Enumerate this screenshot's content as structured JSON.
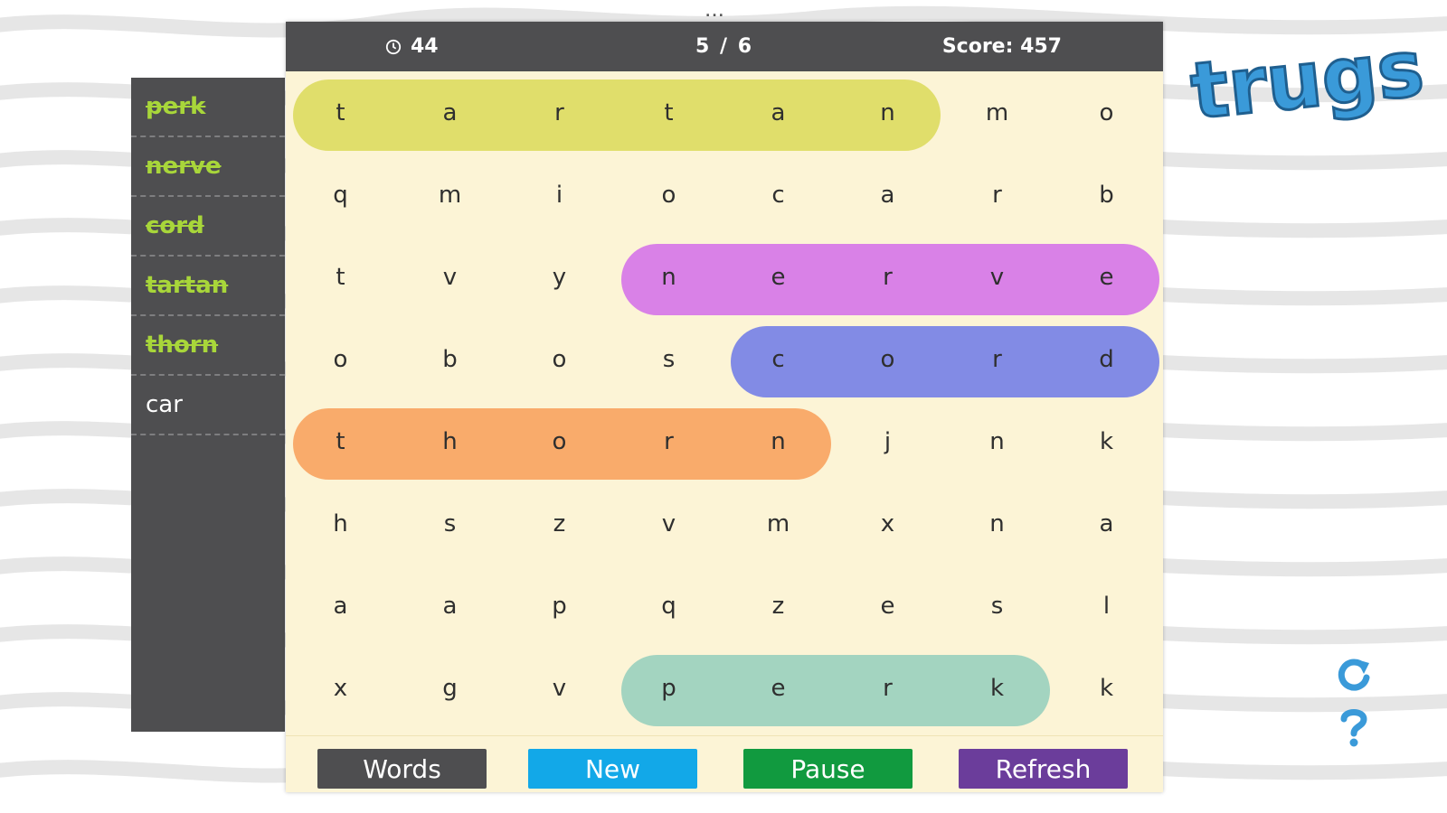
{
  "menu": {
    "dots": "..."
  },
  "sidebar": {
    "words": [
      {
        "text": "perk",
        "found": true
      },
      {
        "text": "nerve",
        "found": true
      },
      {
        "text": "cord",
        "found": true
      },
      {
        "text": "tartan",
        "found": true
      },
      {
        "text": "thorn",
        "found": true
      },
      {
        "text": "car",
        "found": false
      }
    ]
  },
  "header": {
    "timer": "44",
    "found": "5",
    "separator": "/",
    "total": "6",
    "score_label": "Score:",
    "score": "457"
  },
  "grid": {
    "rows": [
      [
        "t",
        "a",
        "r",
        "t",
        "a",
        "n",
        "m",
        "o"
      ],
      [
        "q",
        "m",
        "i",
        "o",
        "c",
        "a",
        "r",
        "b"
      ],
      [
        "t",
        "v",
        "y",
        "n",
        "e",
        "r",
        "v",
        "e"
      ],
      [
        "o",
        "b",
        "o",
        "s",
        "c",
        "o",
        "r",
        "d"
      ],
      [
        "t",
        "h",
        "o",
        "r",
        "n",
        "j",
        "n",
        "k"
      ],
      [
        "h",
        "s",
        "z",
        "v",
        "m",
        "x",
        "n",
        "a"
      ],
      [
        "a",
        "a",
        "p",
        "q",
        "z",
        "e",
        "s",
        "l"
      ],
      [
        "x",
        "g",
        "v",
        "p",
        "e",
        "r",
        "k",
        "k"
      ]
    ],
    "found_words": [
      {
        "word": "tartan",
        "row": 0,
        "col_start": 0,
        "col_end": 5,
        "color": "#dedc65"
      },
      {
        "word": "nerve",
        "row": 2,
        "col_start": 3,
        "col_end": 7,
        "color": "#d77ae8"
      },
      {
        "word": "cord",
        "row": 3,
        "col_start": 4,
        "col_end": 7,
        "color": "#7b85e6"
      },
      {
        "word": "thorn",
        "row": 4,
        "col_start": 0,
        "col_end": 4,
        "color": "#f9a765"
      },
      {
        "word": "perk",
        "row": 7,
        "col_start": 3,
        "col_end": 6,
        "color": "#9ed2bf"
      }
    ]
  },
  "buttons": [
    {
      "id": "words",
      "label": "Words",
      "color": "#4e4e50"
    },
    {
      "id": "new",
      "label": "New",
      "color": "#12a8e8"
    },
    {
      "id": "pause",
      "label": "Pause",
      "color": "#119a3f"
    },
    {
      "id": "refresh",
      "label": "Refresh",
      "color": "#6b3d9b"
    }
  ],
  "logo": {
    "text": "trugs",
    "color": "#3a9ad9"
  },
  "icons": {
    "restart": "restart-icon",
    "help": "help-icon",
    "accent": "#3a9ad9"
  }
}
